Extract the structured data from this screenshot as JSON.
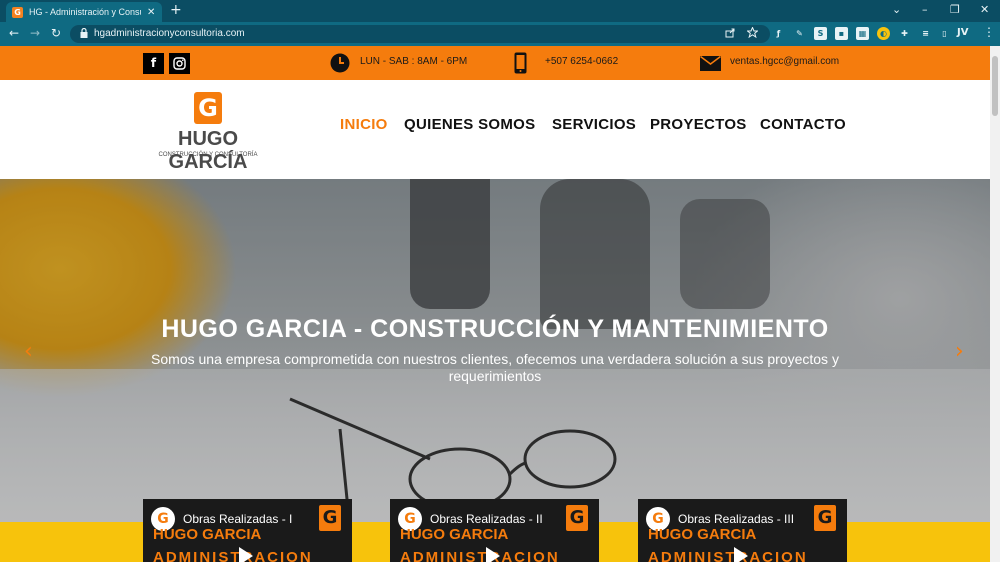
{
  "browser": {
    "tab_title": "HG - Administración y Consultoría",
    "tab_close": "✕",
    "new_tab": "+",
    "url": "hgadministracionyconsultoria.com",
    "profile": "JV",
    "window_controls": {
      "chevron": "⌄",
      "minimize": "–",
      "restore": "❐",
      "close": "✕"
    },
    "nav": {
      "back": "←",
      "forward": "→",
      "reload": "↻"
    }
  },
  "topbar": {
    "hours": "LUN - SAB : 8AM - 6PM",
    "phone": "+507 6254-0662",
    "email": "ventas.hgcc@gmail.com",
    "accent": "#f57c0d"
  },
  "logo": {
    "mark": "G",
    "name": "HUGO GARCÍA",
    "tagline": "CONSTRUCCIÓN Y CONSULTORÍA"
  },
  "nav": {
    "items": [
      {
        "label": "INICIO",
        "active": true
      },
      {
        "label": "QUIENES SOMOS",
        "active": false
      },
      {
        "label": "SERVICIOS",
        "active": false
      },
      {
        "label": "PROYECTOS",
        "active": false
      },
      {
        "label": "CONTACTO",
        "active": false
      }
    ]
  },
  "hero": {
    "title": "HUGO GARCIA - CONSTRUCCIÓN Y MANTENIMIENTO",
    "subtitle": "Somos una empresa comprometida con nuestros clientes, ofecemos una verdadera solución a sus proyectos y requerimientos",
    "prev": "‹",
    "next": "›"
  },
  "videos": [
    {
      "title": "Obras Realizadas - I",
      "name": "HUGO GARCIA",
      "admin": "ADMINISTRACION",
      "channel": "G"
    },
    {
      "title": "Obras Realizadas - II",
      "name": "HUGO GARCIA",
      "admin": "ADMINISTRACION",
      "channel": "G"
    },
    {
      "title": "Obras Realizadas - III",
      "name": "HUGO GARCIA",
      "admin": "ADMINISTRACION",
      "channel": "G"
    }
  ],
  "icons": {
    "facebook": "f",
    "instagram": "◎",
    "clock": "clock-icon",
    "phone": "phone-icon",
    "mail": "mail-icon"
  }
}
